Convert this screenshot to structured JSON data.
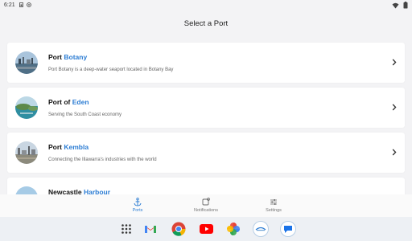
{
  "status": {
    "time": "6:21"
  },
  "header": {
    "title": "Select a Port"
  },
  "ports": [
    {
      "prefix": "Port ",
      "highlight": "Botany",
      "suffix": "",
      "description": "Port Botany is a deep-water seaport located in Botany Bay"
    },
    {
      "prefix": "Port of ",
      "highlight": "Eden",
      "suffix": "",
      "description": "Serving the South Coast economy"
    },
    {
      "prefix": "Port ",
      "highlight": "Kembla",
      "suffix": "",
      "description": "Connecting the Illawarra's industries with the world"
    },
    {
      "prefix": "Newcastle ",
      "highlight": "Harbour",
      "suffix": "",
      "description": ""
    }
  ],
  "nav": {
    "ports_label": "Ports",
    "notifications_label": "Notifications",
    "settings_label": "Settings"
  },
  "colors": {
    "accent": "#2b7cd3",
    "background": "#f3f3f5"
  },
  "dock": {
    "icons": [
      "app-drawer-icon",
      "gmail-icon",
      "chrome-icon",
      "youtube-icon",
      "photos-icon",
      "ports-app-icon",
      "messages-icon"
    ]
  }
}
